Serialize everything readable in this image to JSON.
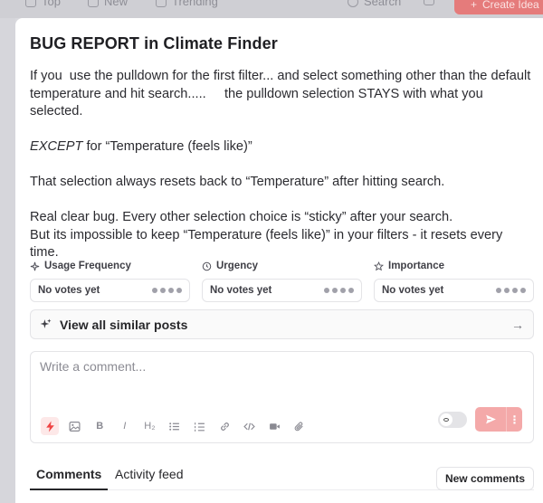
{
  "background": {
    "nav": [
      {
        "label": "Top",
        "icon": "arrow-icon"
      },
      {
        "label": "New",
        "icon": "sparkle-icon"
      },
      {
        "label": "Trending",
        "icon": "trending-icon"
      }
    ],
    "search_label": "Search",
    "create_label": "Create Idea"
  },
  "post": {
    "title": "BUG REPORT in Climate Finder",
    "paragraphs": [
      "If you  use the pulldown for the first filter... and select something other than the default temperature and hit search.....     the pulldown selection STAYS with what you selected.",
      "EXCEPT",
      "That selection always resets back to “Temperature” after hitting search.",
      "Real clear bug. Every other selection choice is “sticky” after your search.\nBut its impossible to keep “Temperature (feels like)” in your filters - it resets every time."
    ],
    "except_suffix": " for “Temperature (feels like)”"
  },
  "votes": [
    {
      "label": "Usage Frequency",
      "icon": "sparkle-icon",
      "value": "No votes yet"
    },
    {
      "label": "Urgency",
      "icon": "clock-icon",
      "value": "No votes yet"
    },
    {
      "label": "Importance",
      "icon": "star-icon",
      "value": "No votes yet"
    }
  ],
  "similar": {
    "label": "View all similar posts"
  },
  "comment": {
    "placeholder": "Write a comment...",
    "toolbar": [
      "lightning-icon",
      "image-icon",
      "bold-icon",
      "italic-icon",
      "heading-icon",
      "bullet-list-icon",
      "numbered-list-icon",
      "link-icon",
      "code-icon",
      "video-icon",
      "attachment-icon"
    ],
    "toolbar_text": {
      "bold": "B",
      "italic": "I",
      "heading": "H₂"
    }
  },
  "tabs": {
    "comments": "Comments",
    "activity": "Activity feed",
    "new_comments": "New comments"
  },
  "colors": {
    "accent": "#ef4444",
    "accent_light": "#f4a9a9",
    "border": "#e4e4e7"
  }
}
